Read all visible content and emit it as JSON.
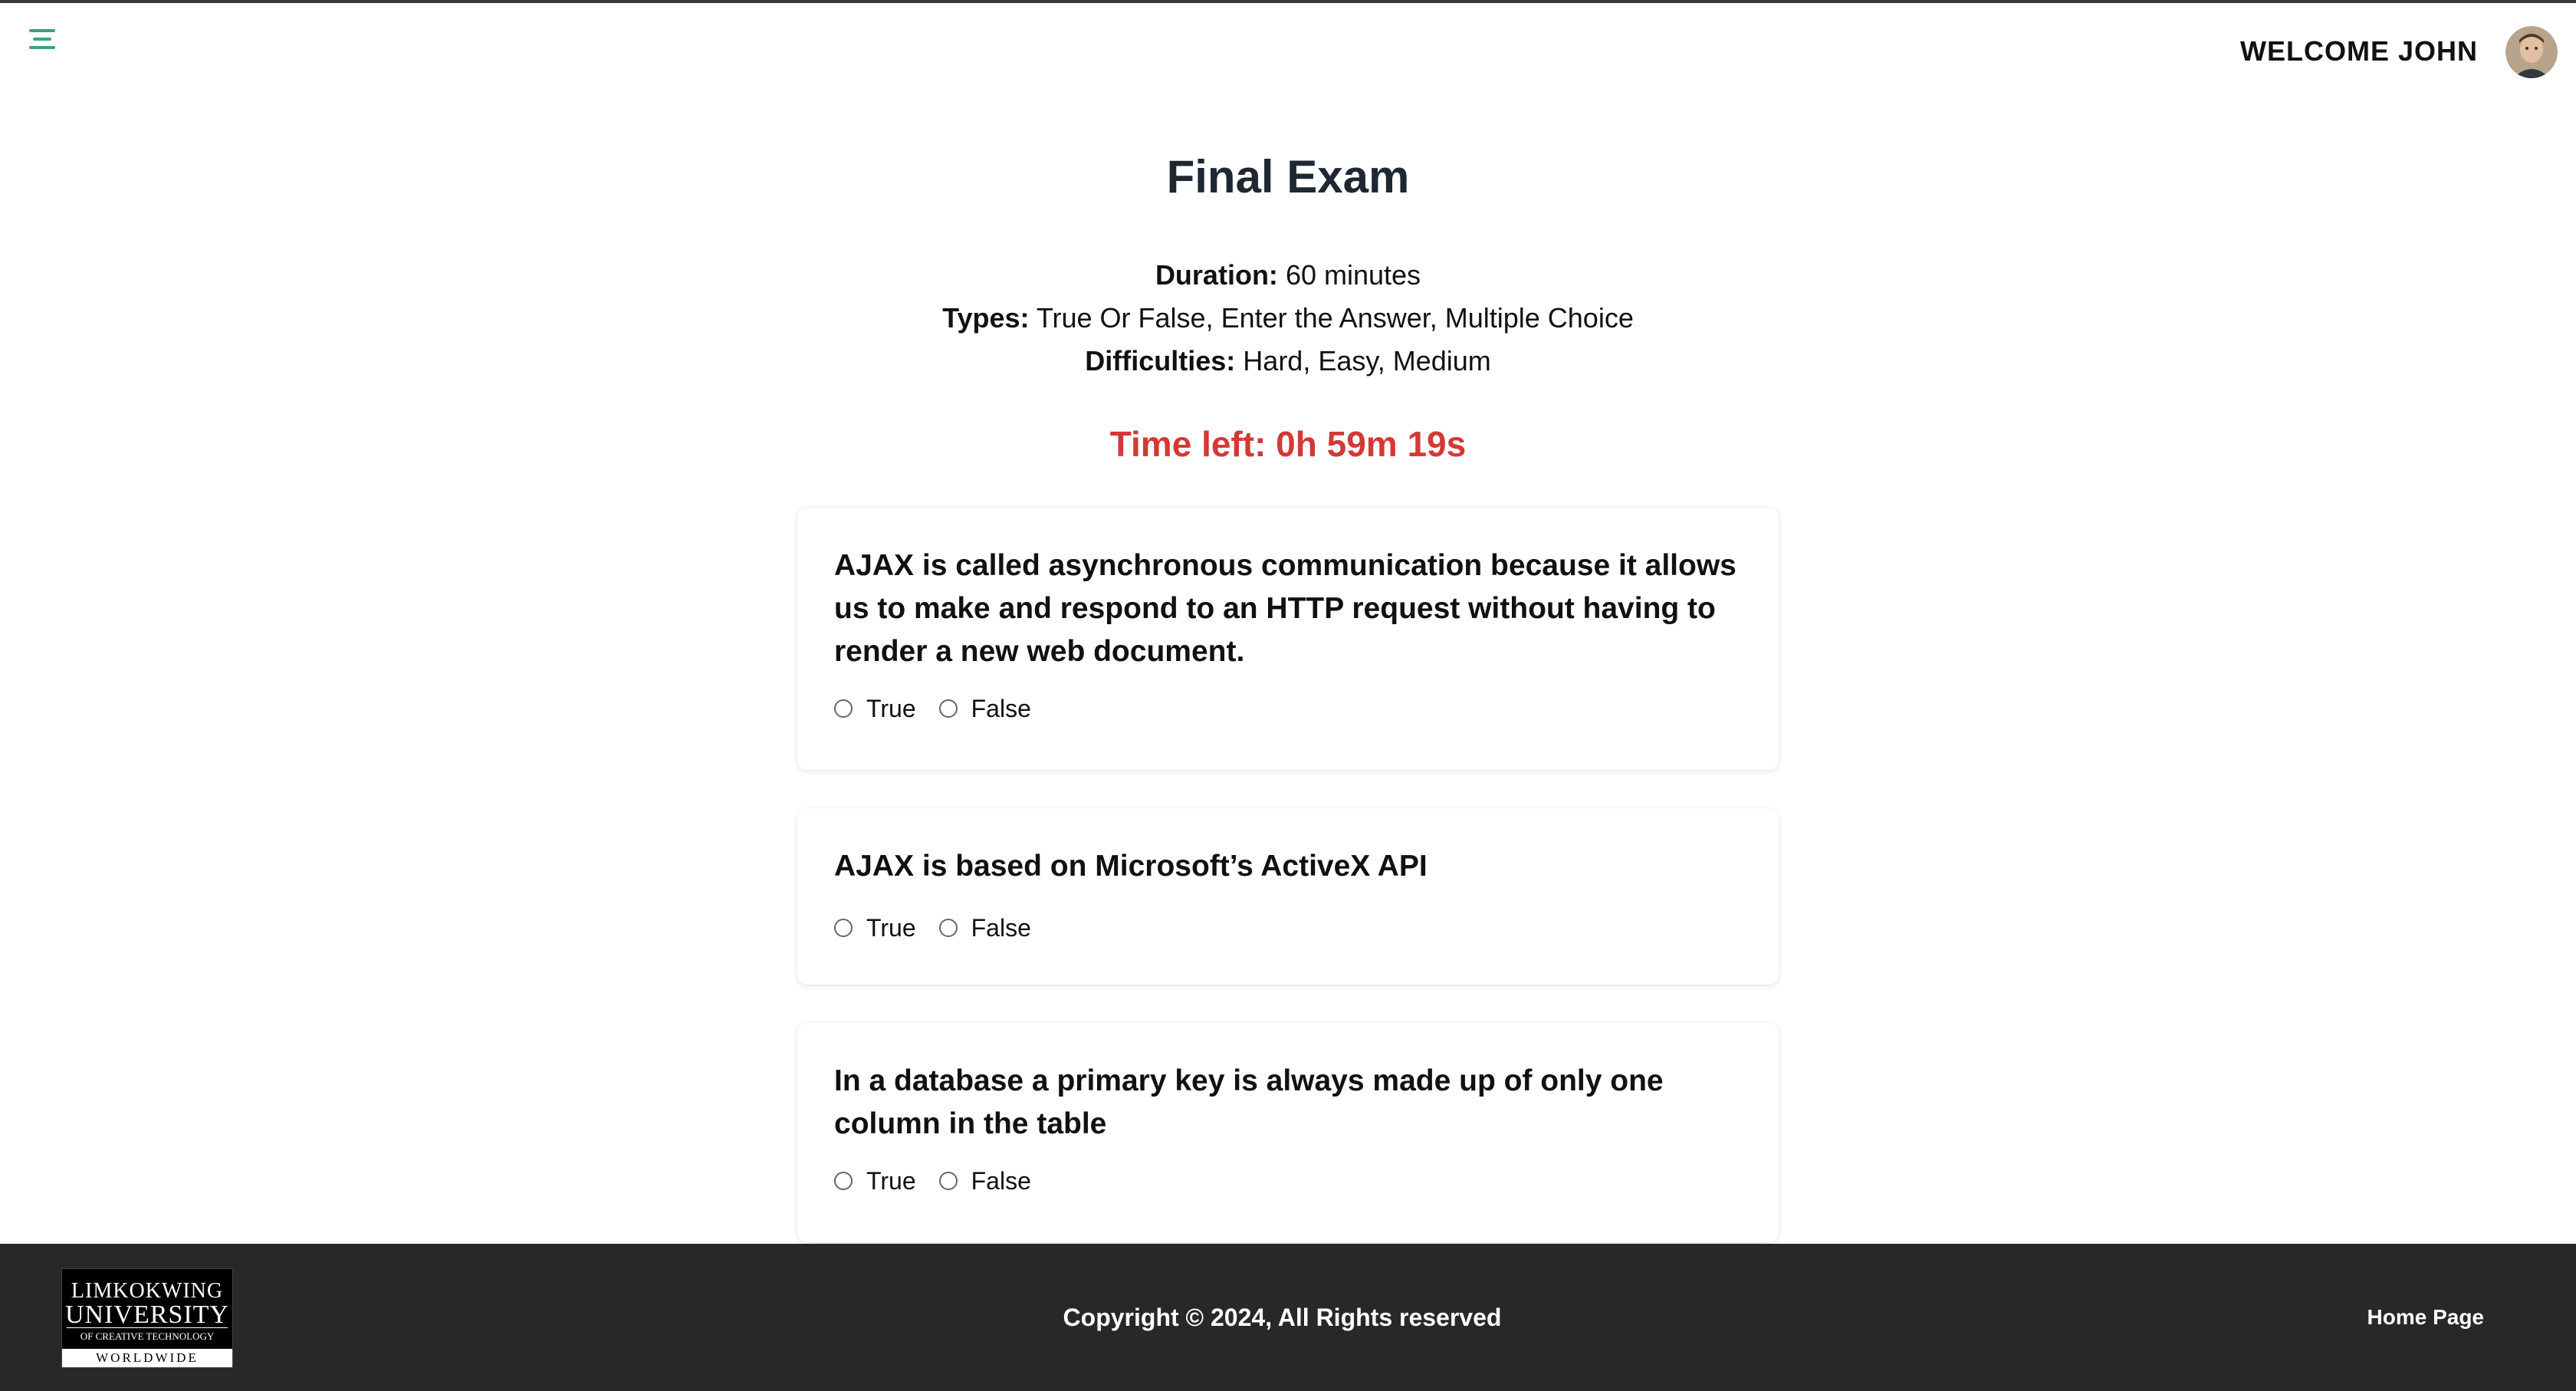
{
  "header": {
    "welcome_text": "WELCOME JOHN",
    "menu_icon": "hamburger-menu-icon",
    "accent_color": "#3aa189"
  },
  "exam": {
    "title": "Final Exam",
    "duration_label": "Duration:",
    "duration_value": "60 minutes",
    "types_label": "Types:",
    "types_value": "True Or False, Enter the Answer, Multiple Choice",
    "difficulties_label": "Difficulties:",
    "difficulties_value": "Hard, Easy, Medium",
    "time_left": "Time left: 0h 59m 19s",
    "timer_color": "#d13a35"
  },
  "questions": [
    {
      "text": "AJAX is called asynchronous communication because it allows us to make and respond to an HTTP request without having to render a new web document.",
      "options": [
        "True",
        "False"
      ]
    },
    {
      "text": "AJAX is based on Microsoft’s ActiveX API",
      "options": [
        "True",
        "False"
      ]
    },
    {
      "text": "In a database a primary key is always made up of only one column in the table",
      "options": [
        "True",
        "False"
      ]
    }
  ],
  "footer": {
    "logo_line1": "LIMKOKWING",
    "logo_line2": "UNIVERSITY",
    "logo_line3": "OF CREATIVE TECHNOLOGY",
    "logo_line4": "WORLDWIDE",
    "copyright": "Copyright © 2024, All Rights reserved",
    "home_link": "Home Page",
    "background_color": "#282828"
  }
}
